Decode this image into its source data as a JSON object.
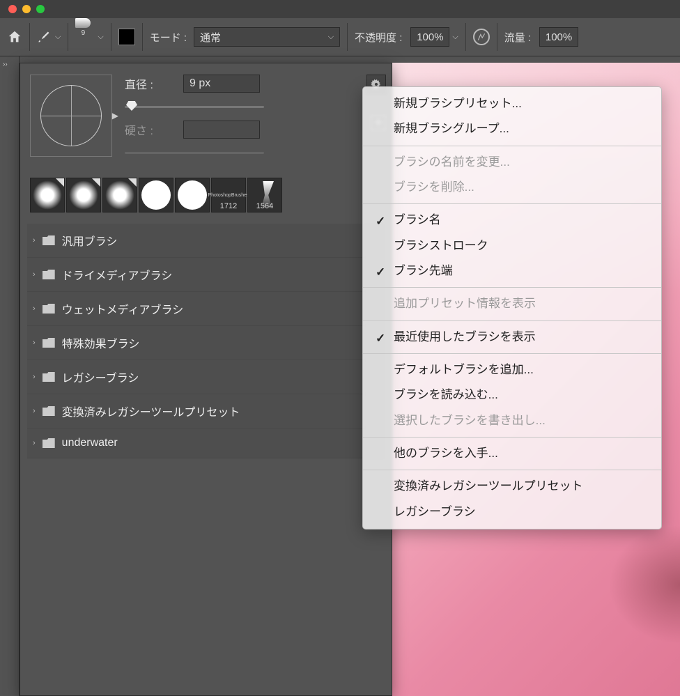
{
  "titlebar": {},
  "optionbar": {
    "tip_size": "9",
    "mode_label": "モード :",
    "mode_value": "通常",
    "opacity_label": "不透明度 :",
    "opacity_value": "100%",
    "flow_label": "流量 :",
    "flow_value": "100%"
  },
  "brush_panel": {
    "diameter_label": "直径 :",
    "diameter_value": "9 px",
    "hardness_label": "硬さ :",
    "hardness_value": "",
    "recent": [
      {
        "kind": "soft",
        "corner": true
      },
      {
        "kind": "soft",
        "corner": true
      },
      {
        "kind": "soft",
        "corner": true
      },
      {
        "kind": "hard"
      },
      {
        "kind": "hard"
      },
      {
        "kind": "custom",
        "label": "1712",
        "text": "PhotoshopBrushes"
      },
      {
        "kind": "wisp",
        "label": "1564"
      }
    ],
    "folders": [
      {
        "label": "汎用ブラシ"
      },
      {
        "label": "ドライメディアブラシ"
      },
      {
        "label": "ウェットメディアブラシ"
      },
      {
        "label": "特殊効果ブラシ"
      },
      {
        "label": "レガシーブラシ"
      },
      {
        "label": "変換済みレガシーツールプリセット"
      },
      {
        "label": "underwater"
      }
    ]
  },
  "flyout": {
    "groups": [
      [
        {
          "label": "新規ブラシプリセット...",
          "enabled": true
        },
        {
          "label": "新規ブラシグループ...",
          "enabled": true
        }
      ],
      [
        {
          "label": "ブラシの名前を変更...",
          "enabled": false
        },
        {
          "label": "ブラシを削除...",
          "enabled": false
        }
      ],
      [
        {
          "label": "ブラシ名",
          "enabled": true,
          "checked": true
        },
        {
          "label": "ブラシストローク",
          "enabled": true
        },
        {
          "label": "ブラシ先端",
          "enabled": true,
          "checked": true
        }
      ],
      [
        {
          "label": "追加プリセット情報を表示",
          "enabled": false
        }
      ],
      [
        {
          "label": "最近使用したブラシを表示",
          "enabled": true,
          "checked": true
        }
      ],
      [
        {
          "label": "デフォルトブラシを追加...",
          "enabled": true
        },
        {
          "label": "ブラシを読み込む...",
          "enabled": true
        },
        {
          "label": "選択したブラシを書き出し...",
          "enabled": false
        }
      ],
      [
        {
          "label": "他のブラシを入手...",
          "enabled": true
        }
      ],
      [
        {
          "label": "変換済みレガシーツールプリセット",
          "enabled": true
        },
        {
          "label": "レガシーブラシ",
          "enabled": true
        }
      ]
    ]
  }
}
